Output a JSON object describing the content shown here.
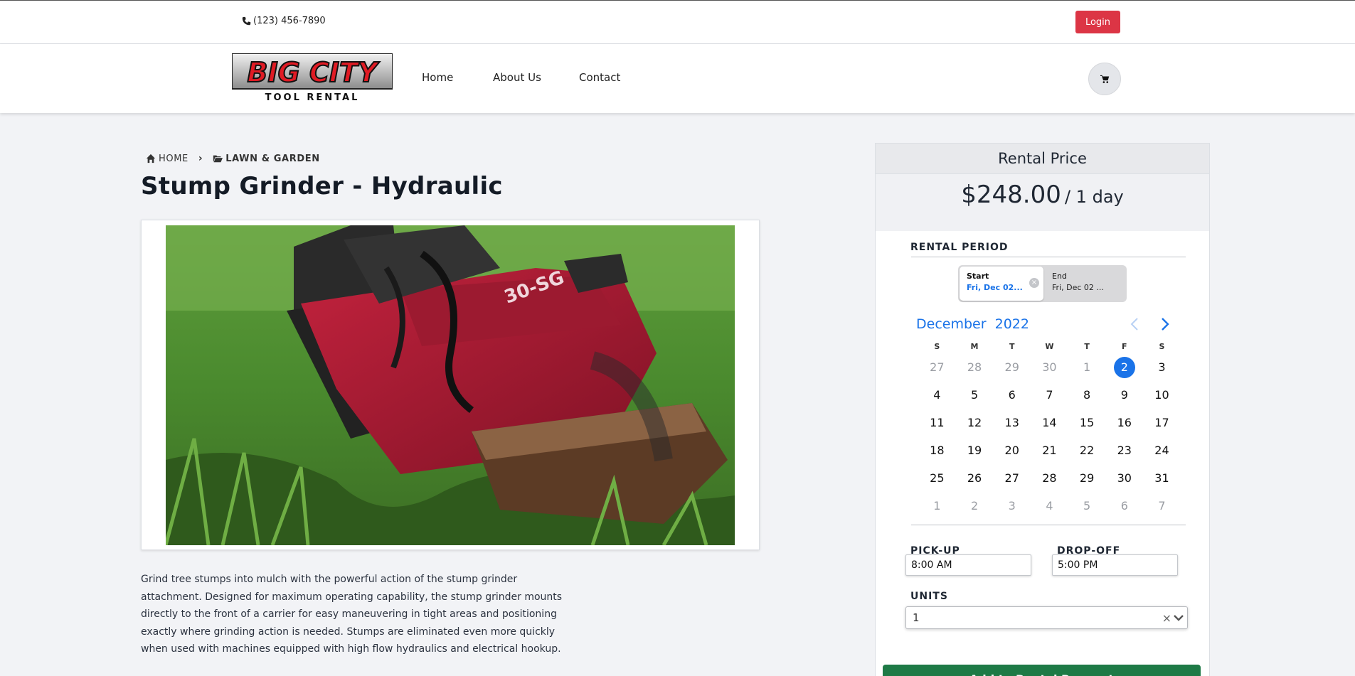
{
  "topbar": {
    "phone": "(123) 456-7890",
    "login_label": "Login"
  },
  "navbar": {
    "logo_top": "BIG CITY",
    "logo_bottom": "TOOL RENTAL",
    "links": [
      "Home",
      "About Us",
      "Contact"
    ],
    "cart_icon": "cart-icon"
  },
  "breadcrumb": {
    "home": "HOME",
    "category": "LAWN & GARDEN"
  },
  "product": {
    "title": "Stump Grinder - Hydraulic",
    "description": "Grind tree stumps into mulch with the powerful action of the stump grinder attachment. Designed for maximum operating capability, the stump grinder mounts directly to the front of a carrier for easy maneuvering in tight areas and positioning exactly where grinding action is needed. Stumps are eliminated even more quickly when used with machines equipped with high flow hydraulics and electrical hookup.",
    "image_text": "30-SG"
  },
  "rental": {
    "header": "Rental Price",
    "price": "$248.00",
    "per": "/ 1 day",
    "period_label": "RENTAL PERIOD",
    "start_label": "Start",
    "start_value": "Fri, Dec 02...",
    "end_label": "End",
    "end_value": "Fri, Dec 02 ...",
    "calendar": {
      "month": "December",
      "year": "2022",
      "dow": [
        "S",
        "M",
        "T",
        "W",
        "T",
        "F",
        "S"
      ],
      "weeks": [
        [
          {
            "d": "27",
            "m": true
          },
          {
            "d": "28",
            "m": true
          },
          {
            "d": "29",
            "m": true
          },
          {
            "d": "30",
            "m": true
          },
          {
            "d": "1",
            "m": true
          },
          {
            "d": "2",
            "s": true
          },
          {
            "d": "3"
          }
        ],
        [
          {
            "d": "4"
          },
          {
            "d": "5"
          },
          {
            "d": "6"
          },
          {
            "d": "7"
          },
          {
            "d": "8"
          },
          {
            "d": "9"
          },
          {
            "d": "10"
          }
        ],
        [
          {
            "d": "11"
          },
          {
            "d": "12"
          },
          {
            "d": "13"
          },
          {
            "d": "14"
          },
          {
            "d": "15"
          },
          {
            "d": "16"
          },
          {
            "d": "17"
          }
        ],
        [
          {
            "d": "18"
          },
          {
            "d": "19"
          },
          {
            "d": "20"
          },
          {
            "d": "21"
          },
          {
            "d": "22"
          },
          {
            "d": "23"
          },
          {
            "d": "24"
          }
        ],
        [
          {
            "d": "25"
          },
          {
            "d": "26"
          },
          {
            "d": "27"
          },
          {
            "d": "28"
          },
          {
            "d": "29"
          },
          {
            "d": "30"
          },
          {
            "d": "31"
          }
        ],
        [
          {
            "d": "1",
            "g": true
          },
          {
            "d": "2",
            "g": true
          },
          {
            "d": "3",
            "g": true
          },
          {
            "d": "4",
            "g": true
          },
          {
            "d": "5",
            "g": true
          },
          {
            "d": "6",
            "g": true
          },
          {
            "d": "7",
            "g": true
          }
        ]
      ]
    },
    "pickup_label": "PICK-UP",
    "pickup_value": "8:00 AM",
    "dropoff_label": "DROP-OFF",
    "dropoff_value": "5:00 PM",
    "units_label": "UNITS",
    "units_value": "1",
    "add_button": "Add to Rental Request"
  },
  "colors": {
    "login": "#dc3545",
    "accent_blue": "#1a73e8",
    "add_button": "#1e7a46",
    "background": "#f2f3f6"
  }
}
